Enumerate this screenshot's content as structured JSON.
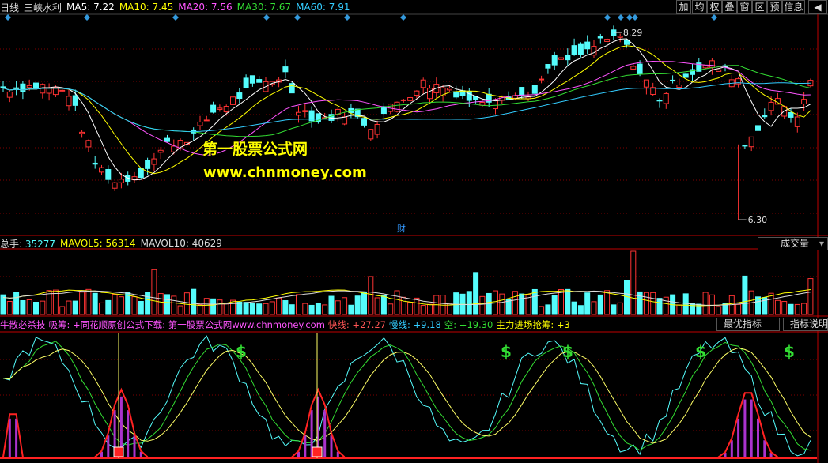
{
  "header": {
    "period": "日线",
    "stock_name": "三峡水利",
    "ma": [
      {
        "label": "MA5: 7.22",
        "color": "#ffffff"
      },
      {
        "label": "MA10: 7.45",
        "color": "#ffff00"
      },
      {
        "label": "MA20: 7.56",
        "color": "#ff55ff"
      },
      {
        "label": "MA30: 7.67",
        "color": "#33dd33"
      },
      {
        "label": "MA60: 7.91",
        "color": "#33ccff"
      }
    ]
  },
  "toolbar": [
    "加",
    "均",
    "权",
    "叠",
    "窗",
    "区",
    "预",
    "信息",
    "◀"
  ],
  "watermark": {
    "line1": "第一股票公式网",
    "line2": "www.chnmoney.com"
  },
  "price_panel": {
    "high_label": "8.29",
    "low_label": "6.30",
    "finance_marker": "财"
  },
  "volume_panel": {
    "title": "总手: ",
    "total": "35277",
    "mavol5": "MAVOL5: 56314",
    "mavol10": "MAVOL10: 40629",
    "button": "成交量"
  },
  "indicator_panel": {
    "name": "牛散必杀技",
    "text1": "吸筹: +同花顺原创公式下载: 第一股票公式网www.chnmoney.com",
    "kuai": "快线: +27.27",
    "man": "慢线: +9.18",
    "kong": "空: +19.30",
    "zhuli": "主力进场抢筹: +3",
    "btn_best": "最优指标",
    "btn_help": "指标说明",
    "dollar": "$"
  },
  "colors": {
    "up": "#ff3333",
    "down": "#54fcfc",
    "ma5": "#ffffff",
    "ma10": "#ffff00",
    "ma20": "#ff55ff",
    "ma30": "#33dd33",
    "ma60": "#33ccff",
    "grid": "#800000",
    "diamond": "#3399dd"
  },
  "chart_data": {
    "type": "candlestick",
    "price": {
      "ylim": [
        6.2,
        8.45
      ],
      "high_marker": 8.29,
      "low_marker": 6.3,
      "ma_latest": {
        "MA5": 7.22,
        "MA10": 7.45,
        "MA20": 7.56,
        "MA30": 7.67,
        "MA60": 7.91
      }
    },
    "volume": {
      "total": 35277,
      "mavol5": 56314,
      "mavol10": 40629
    },
    "indicator": {
      "kuai": 27.27,
      "man": 9.18,
      "kong": 19.3
    }
  }
}
